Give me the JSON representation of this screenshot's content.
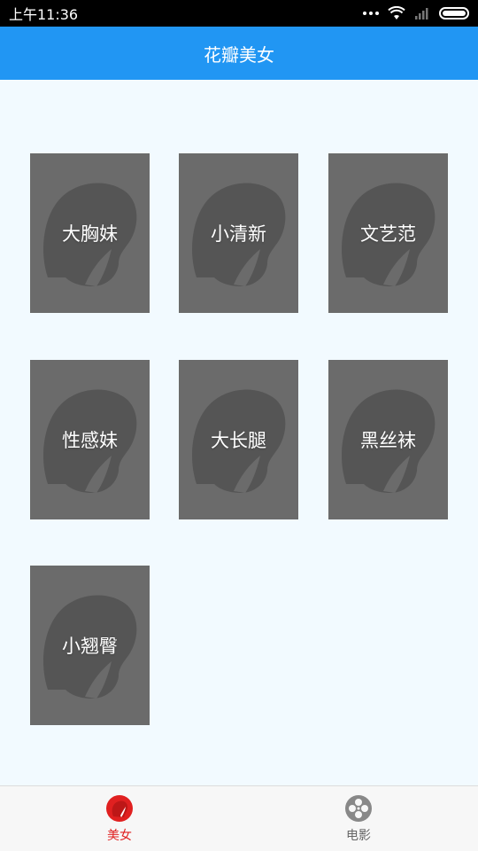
{
  "status_bar": {
    "time": "上午11:36",
    "icons": [
      "more-dots-icon",
      "wifi-icon",
      "signal-icon",
      "battery-icon"
    ]
  },
  "app_bar": {
    "title": "花瓣美女"
  },
  "categories": [
    {
      "label": "大胸妹"
    },
    {
      "label": "小清新"
    },
    {
      "label": "文艺范"
    },
    {
      "label": "性感妹"
    },
    {
      "label": "大长腿"
    },
    {
      "label": "黑丝袜"
    },
    {
      "label": "小翘臀"
    }
  ],
  "bottom_nav": {
    "tabs": [
      {
        "label": "美女",
        "icon": "beauty-icon",
        "active": true
      },
      {
        "label": "电影",
        "icon": "film-reel-icon",
        "active": false
      }
    ]
  },
  "colors": {
    "app_bar": "#2196f3",
    "tile": "#6b6b6b",
    "active_tab": "#e02020",
    "inactive_tab": "#888888"
  }
}
